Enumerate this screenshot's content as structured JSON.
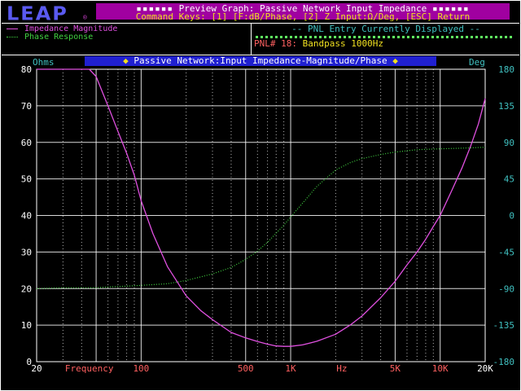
{
  "header": {
    "logo": "LEAP",
    "logo_mark": "®",
    "title": "Preview Graph: Passive Network Input Impedance",
    "command_keys": "Command Keys: [1] [F:dB/Phase, [2] Z Input:Ω/Deg, [ESC] Return"
  },
  "legend": [
    {
      "label": "Impedance Magnitude",
      "color": "#e050e0",
      "style": "solid"
    },
    {
      "label": "Phase Response",
      "color": "#40d040",
      "style": "dotted"
    }
  ],
  "pnl_panel": {
    "header": "-- PNL Entry Currently Displayed --",
    "entry_label": "PNL# 18:",
    "entry_value": "Bandpass 1000Hz"
  },
  "colors": {
    "magnitude": "#e050e0",
    "phase": "#40d040",
    "axis_text": "#40c0c0",
    "left_ticks": "#ffffff",
    "freq_ticks": "#ff6060",
    "title_bar": "#2020d0",
    "header_bar": "#a000a0"
  },
  "chart_data": {
    "type": "line",
    "title": "Passive Network:Input Impedance-Magnitude/Phase",
    "xlabel": "Frequency",
    "xunit": "Hz",
    "xscale": "log",
    "xlim": [
      20,
      20000
    ],
    "x_ticks": [
      {
        "value": 20,
        "label": "20"
      },
      {
        "value": 100,
        "label": "100"
      },
      {
        "value": 500,
        "label": "500"
      },
      {
        "value": 1000,
        "label": "1K"
      },
      {
        "value": 5000,
        "label": "5K"
      },
      {
        "value": 10000,
        "label": "10K"
      },
      {
        "value": 20000,
        "label": "20K"
      }
    ],
    "ylabel_left": "Ohms",
    "ylim_left": [
      0,
      80
    ],
    "y_ticks_left": [
      0,
      10,
      20,
      30,
      40,
      50,
      60,
      70,
      80
    ],
    "ylabel_right": "Deg",
    "ylim_right": [
      -180,
      180
    ],
    "y_ticks_right": [
      -180,
      -135,
      -90,
      -45,
      0,
      45,
      90,
      135,
      180
    ],
    "grid": true,
    "series": [
      {
        "name": "Impedance Magnitude",
        "axis": "left",
        "x": [
          20,
          25,
          30,
          35,
          40,
          45,
          50,
          60,
          70,
          80,
          90,
          100,
          120,
          150,
          200,
          250,
          300,
          400,
          500,
          600,
          700,
          800,
          900,
          1000,
          1200,
          1500,
          2000,
          2500,
          3000,
          4000,
          5000,
          6000,
          7000,
          8000,
          9000,
          10000,
          12000,
          14000,
          16000,
          18000,
          20000
        ],
        "y": [
          80,
          80,
          80,
          80,
          80,
          80,
          78,
          70,
          63,
          57,
          51,
          44,
          35,
          26,
          18,
          14,
          11.5,
          8,
          6.5,
          5.5,
          4.8,
          4.3,
          4.2,
          4.2,
          4.6,
          5.6,
          7.5,
          10,
          12.5,
          17.5,
          22,
          26.5,
          30,
          33.5,
          37,
          40,
          47,
          53,
          59,
          65,
          72
        ]
      },
      {
        "name": "Phase Response",
        "axis": "right",
        "x": [
          20,
          30,
          40,
          50,
          60,
          80,
          100,
          150,
          200,
          300,
          400,
          500,
          600,
          700,
          800,
          900,
          1000,
          1200,
          1500,
          2000,
          2500,
          3000,
          4000,
          5000,
          7000,
          10000,
          15000,
          20000
        ],
        "y": [
          -90,
          -89,
          -89,
          -89,
          -88,
          -87,
          -86,
          -84,
          -80,
          -72,
          -64,
          -54,
          -44,
          -33,
          -22,
          -12,
          -2,
          15,
          36,
          56,
          65,
          70,
          75,
          78,
          81,
          82,
          83,
          84
        ]
      }
    ]
  }
}
